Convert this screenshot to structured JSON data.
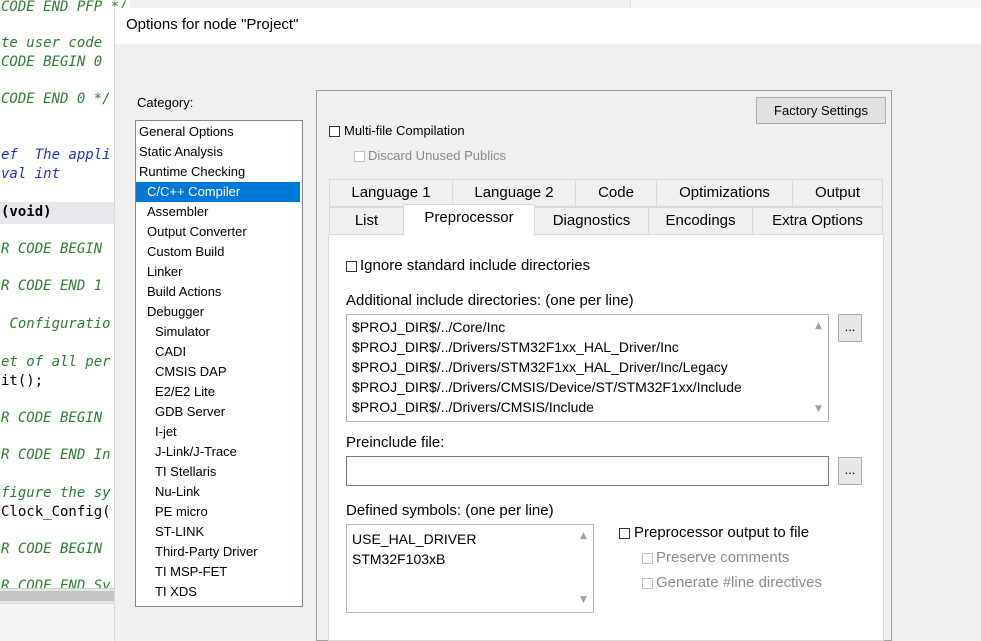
{
  "editor": {
    "lines": [
      {
        "text": "CODE END PFP */",
        "style": "comment"
      },
      {
        "text": "te user code",
        "style": "comment"
      },
      {
        "text": "CODE BEGIN 0",
        "style": "comment"
      },
      {
        "text": "CODE END 0 */",
        "style": "comment"
      },
      {
        "text": "ef  The appli",
        "style": "doc"
      },
      {
        "text": "val int",
        "style": "doc"
      },
      {
        "text": "(void)",
        "style": "bold"
      },
      {
        "text": "R CODE BEGIN",
        "style": "comment"
      },
      {
        "text": "R CODE END 1",
        "style": "comment"
      },
      {
        "text": " Configuratio",
        "style": "comment"
      },
      {
        "text": "et of all per",
        "style": "comment"
      },
      {
        "text": "it();",
        "style": "plain"
      },
      {
        "text": "R CODE BEGIN",
        "style": "comment"
      },
      {
        "text": "R CODE END In",
        "style": "comment"
      },
      {
        "text": "figure the sy",
        "style": "comment"
      },
      {
        "text": "Clock_Config(",
        "style": "plain"
      },
      {
        "text": "R CODE BEGIN",
        "style": "comment"
      },
      {
        "text": "R CODE END Sy",
        "style": "comment"
      }
    ]
  },
  "dialog": {
    "title": "Options for node \"Project\"",
    "category_label": "Category:",
    "categories": [
      {
        "label": "General Options",
        "level": 0
      },
      {
        "label": "Static Analysis",
        "level": 0
      },
      {
        "label": "Runtime Checking",
        "level": 0
      },
      {
        "label": "C/C++ Compiler",
        "level": 1,
        "selected": true
      },
      {
        "label": "Assembler",
        "level": 1
      },
      {
        "label": "Output Converter",
        "level": 1
      },
      {
        "label": "Custom Build",
        "level": 1
      },
      {
        "label": "Linker",
        "level": 1
      },
      {
        "label": "Build Actions",
        "level": 1
      },
      {
        "label": "Debugger",
        "level": 1
      },
      {
        "label": "Simulator",
        "level": 2
      },
      {
        "label": "CADI",
        "level": 2
      },
      {
        "label": "CMSIS DAP",
        "level": 2
      },
      {
        "label": "E2/E2 Lite",
        "level": 2
      },
      {
        "label": "GDB Server",
        "level": 2
      },
      {
        "label": "I-jet",
        "level": 2
      },
      {
        "label": "J-Link/J-Trace",
        "level": 2
      },
      {
        "label": "TI Stellaris",
        "level": 2
      },
      {
        "label": "Nu-Link",
        "level": 2
      },
      {
        "label": "PE micro",
        "level": 2
      },
      {
        "label": "ST-LINK",
        "level": 2
      },
      {
        "label": "Third-Party Driver",
        "level": 2
      },
      {
        "label": "TI MSP-FET",
        "level": 2
      },
      {
        "label": "TI XDS",
        "level": 2
      }
    ],
    "factory_settings": "Factory Settings",
    "multi_file": {
      "label": "Multi-file Compilation",
      "checked": false
    },
    "discard_unused": {
      "label": "Discard Unused Publics",
      "checked": false,
      "enabled": false
    },
    "tabs_row1": [
      "Language 1",
      "Language 2",
      "Code",
      "Optimizations",
      "Output"
    ],
    "tabs_row2": [
      "List",
      "Preprocessor",
      "Diagnostics",
      "Encodings",
      "Extra Options"
    ],
    "active_tab": "Preprocessor",
    "preprocessor": {
      "ignore_std": {
        "label": "Ignore standard include directories",
        "checked": false
      },
      "include_label": "Additional include directories: (one per line)",
      "include_dirs": [
        "$PROJ_DIR$/../Core/Inc",
        "$PROJ_DIR$/../Drivers/STM32F1xx_HAL_Driver/Inc",
        "$PROJ_DIR$/../Drivers/STM32F1xx_HAL_Driver/Inc/Legacy",
        "$PROJ_DIR$/../Drivers/CMSIS/Device/ST/STM32F1xx/Include",
        "$PROJ_DIR$/../Drivers/CMSIS/Include"
      ],
      "browse_label": "...",
      "preinclude_label": "Preinclude file:",
      "preinclude_value": "",
      "defined_label": "Defined symbols: (one per line)",
      "defined_symbols": [
        "USE_HAL_DRIVER",
        "STM32F103xB"
      ],
      "pp_output": {
        "label": "Preprocessor output to file",
        "checked": false
      },
      "preserve_comments": {
        "label": "Preserve comments",
        "checked": false,
        "enabled": false
      },
      "line_directives": {
        "label": "Generate #line directives",
        "checked": false,
        "enabled": false
      }
    }
  }
}
